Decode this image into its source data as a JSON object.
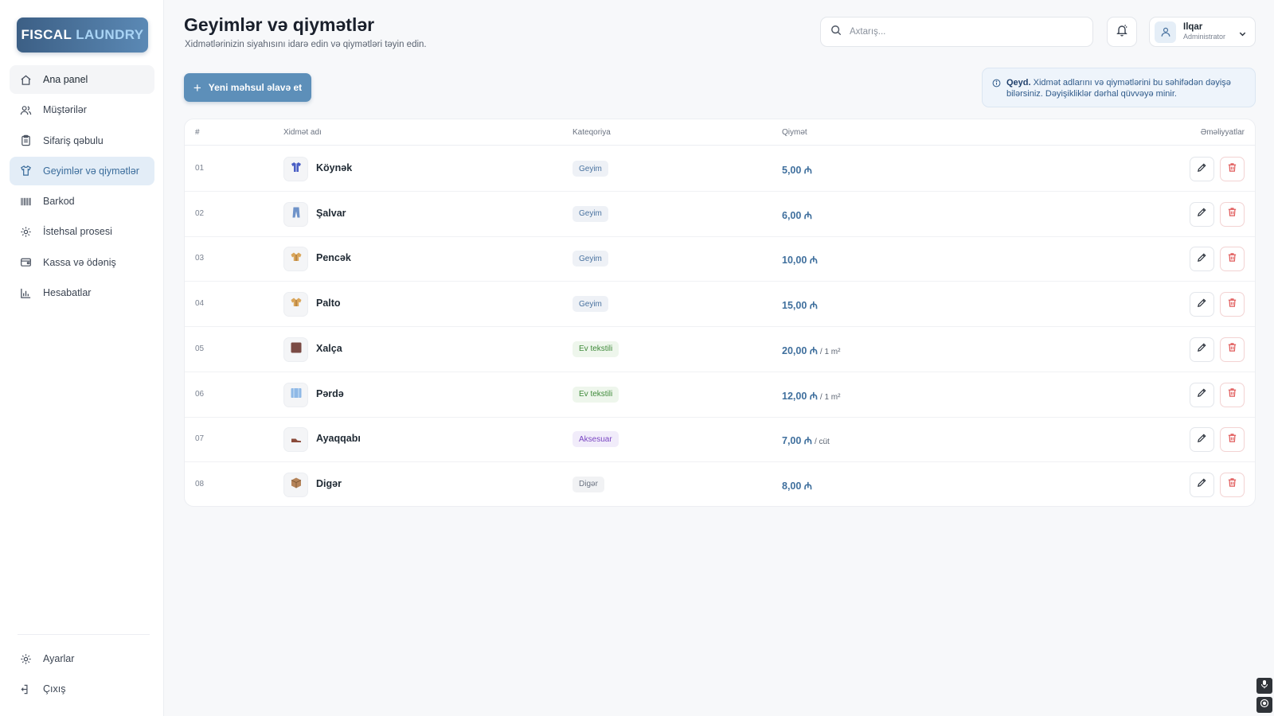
{
  "brand": {
    "word1": "FISCAL",
    "word2": "LAUNDRY"
  },
  "sidebar": {
    "items": [
      {
        "label": "Ana panel",
        "icon": "home-icon"
      },
      {
        "label": "Müştərilər",
        "icon": "users-icon"
      },
      {
        "label": "Sifariş qəbulu",
        "icon": "clipboard-icon"
      },
      {
        "label": "Geyimlər və qiymətlər",
        "icon": "shirt-icon"
      },
      {
        "label": "Barkod",
        "icon": "barcode-icon"
      },
      {
        "label": "İstehsal prosesi",
        "icon": "gear-icon"
      },
      {
        "label": "Kassa və ödəniş",
        "icon": "wallet-icon"
      },
      {
        "label": "Hesabatlar",
        "icon": "chart-icon"
      }
    ],
    "bottom": [
      {
        "label": "Ayarlar",
        "icon": "settings-icon"
      },
      {
        "label": "Çıxış",
        "icon": "logout-icon"
      }
    ]
  },
  "header": {
    "title": "Geyimlər və qiymətlər",
    "subtitle": "Xidmətlərinizin siyahısını idarə edin və qiymətləri təyin edin.",
    "search_placeholder": "Axtarış...",
    "user": {
      "name": "Ilqar",
      "role": "Administrator"
    }
  },
  "toolbar": {
    "add_label": "Yeni məhsul əlavə et",
    "note_bold": "Qeyd.",
    "note_text": "Xidmət adlarını və qiymətlərini bu səhifədən dəyişə bilərsiniz. Dəyişikliklər dərhal qüvvəyə minir."
  },
  "table": {
    "headers": {
      "num": "#",
      "name": "Xidmət adı",
      "category": "Kateqoriya",
      "price": "Qiymət",
      "actions": "Əməliyyatlar"
    },
    "rows": [
      {
        "num": "01",
        "name": "Köynək",
        "category": "Geyim",
        "cat_class": "cat-geyim",
        "price": "5,00 ₼",
        "unit": "",
        "thumb": "shirt",
        "thumb_color": "#4a5fc4"
      },
      {
        "num": "02",
        "name": "Şalvar",
        "category": "Geyim",
        "cat_class": "cat-geyim",
        "price": "6,00 ₼",
        "unit": "",
        "thumb": "pants",
        "thumb_color": "#6f93c9"
      },
      {
        "num": "03",
        "name": "Pencək",
        "category": "Geyim",
        "cat_class": "cat-geyim",
        "price": "10,00 ₼",
        "unit": "",
        "thumb": "coat",
        "thumb_color": "#d9a55a"
      },
      {
        "num": "04",
        "name": "Palto",
        "category": "Geyim",
        "cat_class": "cat-geyim",
        "price": "15,00 ₼",
        "unit": "",
        "thumb": "coat",
        "thumb_color": "#d9a55a"
      },
      {
        "num": "05",
        "name": "Xalça",
        "category": "Ev tekstili",
        "cat_class": "cat-ev",
        "price": "20,00 ₼",
        "unit": "/ 1 m²",
        "thumb": "rug",
        "thumb_color": "#7a4a44"
      },
      {
        "num": "06",
        "name": "Pərdə",
        "category": "Ev tekstili",
        "cat_class": "cat-ev",
        "price": "12,00 ₼",
        "unit": "/ 1 m²",
        "thumb": "curtain",
        "thumb_color": "#8fb9e6"
      },
      {
        "num": "07",
        "name": "Ayaqqabı",
        "category": "Aksesuar",
        "cat_class": "cat-akses",
        "price": "7,00 ₼",
        "unit": "/ cüt",
        "thumb": "shoe",
        "thumb_color": "#8a4a3a"
      },
      {
        "num": "08",
        "name": "Digər",
        "category": "Digər",
        "cat_class": "cat-diger",
        "price": "8,00 ₼",
        "unit": "",
        "thumb": "box",
        "thumb_color": "#b5845a"
      }
    ]
  },
  "colors": {
    "accent": "#5d8fb9",
    "active_bg": "#e3edf7",
    "danger": "#e05a5a",
    "price": "#3f6f9d"
  }
}
